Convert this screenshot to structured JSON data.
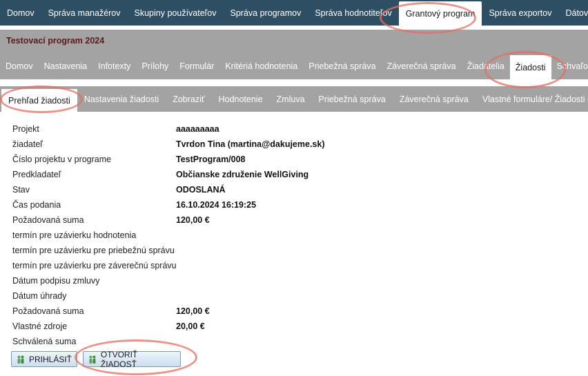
{
  "top_nav": {
    "tabs": [
      {
        "label": "Domov"
      },
      {
        "label": "Správa manažérov"
      },
      {
        "label": "Skupiny používateľov"
      },
      {
        "label": "Správa programov"
      },
      {
        "label": "Správa hodnotiteľov"
      },
      {
        "label": "Grantový program",
        "active": true
      },
      {
        "label": "Správa exportov"
      },
      {
        "label": "Dátové zdr"
      }
    ]
  },
  "program": {
    "title": "Testovací program 2024"
  },
  "program_nav": {
    "tabs": [
      {
        "label": "Domov"
      },
      {
        "label": "Nastavenia"
      },
      {
        "label": "Infotexty"
      },
      {
        "label": "Prílohy"
      },
      {
        "label": "Formulár"
      },
      {
        "label": "Kritériá hodnotenia"
      },
      {
        "label": "Priebežná správa"
      },
      {
        "label": "Záverečná správa"
      },
      {
        "label": "Žiadatelia"
      },
      {
        "label": "Žiadosti",
        "active": true
      },
      {
        "label": "Schvaľova"
      }
    ]
  },
  "application_nav": {
    "tabs": [
      {
        "label": "Prehľad žiadosti",
        "active": true
      },
      {
        "label": "Nastavenia žiadosti"
      },
      {
        "label": "Zobraziť"
      },
      {
        "label": "Hodnotenie"
      },
      {
        "label": "Zmluva"
      },
      {
        "label": "Priebežná správa"
      },
      {
        "label": "Záverečná správa"
      },
      {
        "label": "Vlastné formuláre/ Žiadosti o zme"
      }
    ]
  },
  "details": [
    {
      "label": "Projekt",
      "value": "aaaaaaaaa"
    },
    {
      "label": "žiadateľ",
      "value": "Tvrdon Tina (martina@dakujeme.sk)"
    },
    {
      "label": "Číslo projektu v programe",
      "value": "TestProgram/008"
    },
    {
      "label": "Predkladateľ",
      "value": "Občianske združenie WellGiving"
    },
    {
      "label": "Stav",
      "value": "ODOSLANÁ"
    },
    {
      "label": "Čas podania",
      "value": "16.10.2024 16:19:25"
    },
    {
      "label": "Požadovaná suma",
      "value": "120,00 €"
    },
    {
      "label": "termín pre uzávierku hodnotenia",
      "value": ""
    },
    {
      "label": "termín pre uzávierku pre priebežnú správu",
      "value": ""
    },
    {
      "label": "termín pre uzávierku pre záverečnú správu",
      "value": ""
    },
    {
      "label": "Dátum podpisu zmluvy",
      "value": ""
    },
    {
      "label": "Dátum úhrady",
      "value": ""
    },
    {
      "label": "Požadovaná suma",
      "value": "120,00 €"
    },
    {
      "label": "Vlastné zdroje",
      "value": "20,00 €"
    },
    {
      "label": "Schválená suma",
      "value": ""
    }
  ],
  "actions": {
    "login_label": "PRIHLÁSIŤ",
    "open_label": "OTVORIŤ ŽIADOSŤ",
    "icon": "users-icon"
  },
  "colors": {
    "top_nav_bg": "#2e4f63",
    "sub_nav_bg": "#a3a3a3",
    "program_title": "#5a1a1a",
    "highlight": "#e27064"
  }
}
